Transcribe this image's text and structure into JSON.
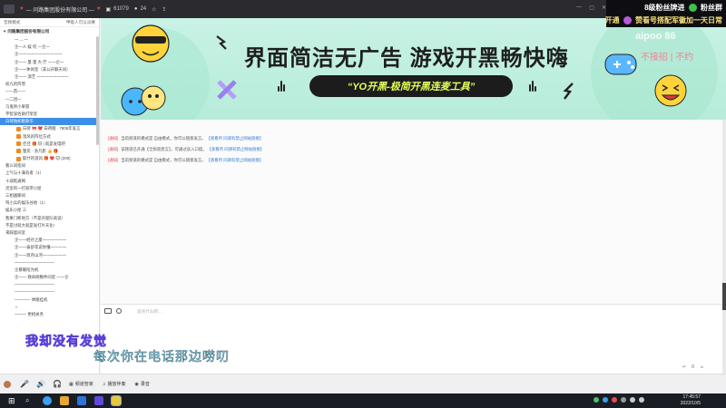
{
  "titlebar": {
    "heart": "♥",
    "channel": "— 问路集团股份有限公司 —",
    "heart2": "♥",
    "count1": "61079",
    "count2": "24"
  },
  "overlay": {
    "line1_a": "8级粉丝牌进",
    "line1_b": "粉丝群",
    "line2": "开通",
    "line2_b": "赞看号搭配军徽加一天日常",
    "cut_text": "aipoo 86",
    "cut_text2": "不接招 | 不约"
  },
  "sidebar": {
    "mode_label": "音频模式",
    "members_label": "甲级人可以派赛",
    "root": "问路集团股份有限公司",
    "rows": [
      {
        "text": "一.....一",
        "indent": true
      },
      {
        "text": "企一人 娱 何 一企一",
        "indent": true
      },
      {
        "text": "企一一一一一一一一一一一",
        "indent": true
      },
      {
        "text": "企一一 量 量 大 厅 一一企一",
        "indent": true
      },
      {
        "text": "企一一休闲室（非公开聊天间）",
        "indent": true
      },
      {
        "text": "企一一 演艺 一一一一一一一一",
        "indent": true
      },
      {
        "text": "初九的阵营",
        "indent": false
      },
      {
        "text": "——苗——",
        "indent": false
      },
      {
        "text": "一二团一",
        "indent": false
      },
      {
        "text": "乌鬼师小果冒",
        "indent": false
      },
      {
        "text": "宇智波佐助打架室",
        "indent": false
      }
    ],
    "active": "白荷独如眠歌华",
    "users": [
      {
        "text": "白荷 🎀 ❤️ 白荷眠 · 7806年发言"
      },
      {
        "text": "温风的阵位方式"
      },
      {
        "text": "佳佳 🎁 🐱 | 就是发电吧"
      },
      {
        "text": "狸花 · 洛凡影 👍 🎁"
      },
      {
        "text": "取什的温风 🎁 ❤️ 🐱 (200)"
      }
    ],
    "rows2": [
      {
        "text": "看么同指间",
        "indent": false
      },
      {
        "text": "上气与十满有者（1）",
        "indent": false
      },
      {
        "text": "十减乾通网",
        "indent": false
      },
      {
        "text": "灵室的一打就带小屋",
        "indent": false
      },
      {
        "text": "三相遍聊间",
        "indent": false
      },
      {
        "text": "驾小兵的娱乐谷地（1）",
        "indent": false
      },
      {
        "text": "娱乐小屋 三",
        "indent": false
      },
      {
        "text": "我果门断地方（不是开屋队就读）",
        "indent": false
      },
      {
        "text": "不是讨就大就是发打片天化!",
        "indent": false
      },
      {
        "text": "来踩蛋间室",
        "indent": false
      },
      {
        "text": "企一一经存之厦一一一一一一",
        "indent": true
      },
      {
        "text": "企一一泰舒花说你懂一一一一",
        "indent": true
      },
      {
        "text": "企一一目月山河一一一一一一",
        "indent": true
      },
      {
        "text": "一一一一一一一一一一",
        "indent": true
      },
      {
        "text": "企暴暖陪为机",
        "indent": true
      },
      {
        "text": "企一一 救命网数件间室 一一企",
        "indent": true
      },
      {
        "text": "一一一一一一一一一一",
        "indent": true
      },
      {
        "text": "一一一一一一一一一一",
        "indent": true
      },
      {
        "text": "一一一一 休眠挂机",
        "indent": true
      },
      {
        "text": "☆",
        "indent": true
      },
      {
        "text": "一一一 更相关务",
        "indent": true
      }
    ]
  },
  "banner": {
    "title": "界面简洁无广告 游戏开黑畅快嗨",
    "pill": "“YO开黑-极简开黑连麦工具”"
  },
  "messages": [
    {
      "prefix": "[通知]",
      "text": "当前频道的模式是 自由模式，你可以随意发言。",
      "link": "【查看所 同调有禁止网站链接】"
    },
    {
      "prefix": "[通知]",
      "text": "该频道已开通【全频道直言】，可通过该入口提。",
      "link": "【查看所 同调有禁止网站链接】"
    },
    {
      "prefix": "[通知]",
      "text": "当前频道的模式是 自由模式，你可以随意发言。",
      "link": "【查看所 同调有禁止网站链接】"
    }
  ],
  "input": {
    "placeholder": "说点什么吧...",
    "send_count": "0",
    "emoji": "☺"
  },
  "lyrics": {
    "line1": "我却没有发觉",
    "line2": "每次你在电话那边唠叨"
  },
  "bottombar": {
    "user_label": "频道管家",
    "music_label": "播放伴奏",
    "record_label": "录音"
  },
  "taskbar": {
    "time": "17:45:57",
    "date": "2022/10/5"
  },
  "colors": {
    "accent": "#3c8ee8",
    "banner_bg": "#c8f2e5",
    "pill_text": "#e6ff5a",
    "overlay_gold": "#f7e17a"
  }
}
